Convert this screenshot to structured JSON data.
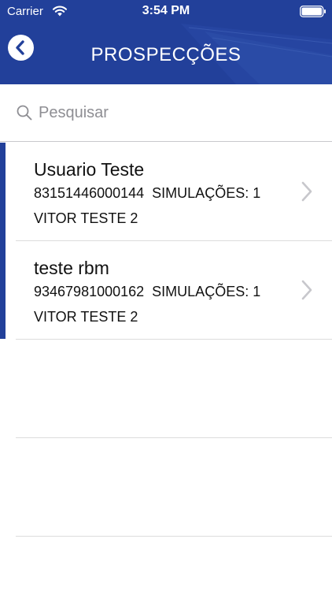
{
  "status_bar": {
    "carrier": "Carrier",
    "time": "3:54 PM"
  },
  "header": {
    "title": "PROSPECÇÕES",
    "back_icon": "chevron-left-icon",
    "bg_color": "#22409a"
  },
  "search": {
    "placeholder": "Pesquisar",
    "value": ""
  },
  "list": {
    "items": [
      {
        "name": "Usuario Teste",
        "doc": "83151446000144",
        "simulations_label": "SIMULAÇÕES: 1",
        "owner": "VITOR TESTE 2"
      },
      {
        "name": "teste rbm",
        "doc": "93467981000162",
        "simulations_label": "SIMULAÇÕES: 1",
        "owner": "VITOR TESTE 2"
      }
    ]
  },
  "colors": {
    "accent": "#22409a",
    "separator": "#dcdcdc",
    "chevron": "#c7c7cc"
  }
}
